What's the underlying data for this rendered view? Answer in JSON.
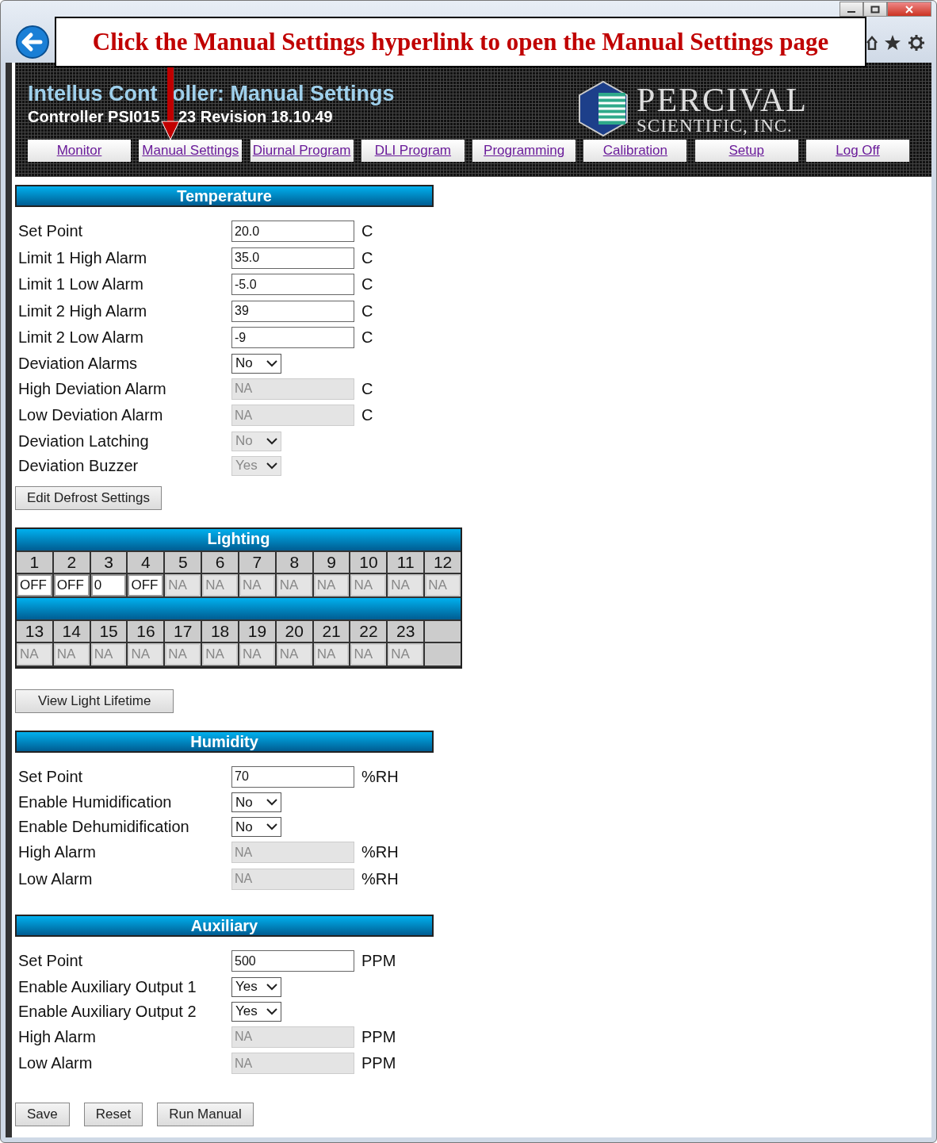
{
  "callout": {
    "text": "Click the Manual Settings hyperlink to open the Manual Settings page"
  },
  "header": {
    "title": [
      "Intellus Cont",
      "oller: Manual Settings"
    ],
    "subtitle": [
      "Controller PSI015",
      "23 Revision 18.10.49"
    ],
    "logo": {
      "name": "PERCIVAL",
      "tagline": "SCIENTIFIC, INC."
    }
  },
  "nav": [
    "Monitor",
    "Manual Settings",
    "Diurnal Program",
    "DLI Program",
    "Programming",
    "Calibration",
    "Setup",
    "Log Off"
  ],
  "sections": [
    {
      "kind": "form",
      "title": "Temperature",
      "rows": [
        {
          "label": "Set Point",
          "kind": "input",
          "value": "20.0",
          "disabled": false,
          "unit": "C"
        },
        {
          "label": "Limit 1 High Alarm",
          "kind": "input",
          "value": "35.0",
          "disabled": false,
          "unit": "C"
        },
        {
          "label": "Limit 1 Low Alarm",
          "kind": "input",
          "value": "-5.0",
          "disabled": false,
          "unit": "C"
        },
        {
          "label": "Limit 2 High Alarm",
          "kind": "input",
          "value": "39",
          "disabled": false,
          "unit": "C"
        },
        {
          "label": "Limit 2 Low Alarm",
          "kind": "input",
          "value": "-9",
          "disabled": false,
          "unit": "C"
        },
        {
          "label": "Deviation Alarms",
          "kind": "select",
          "value": "No",
          "disabled": false
        },
        {
          "label": "High Deviation Alarm",
          "kind": "input",
          "value": "NA",
          "disabled": true,
          "unit": "C"
        },
        {
          "label": "Low Deviation Alarm",
          "kind": "input",
          "value": "NA",
          "disabled": true,
          "unit": "C"
        },
        {
          "label": "Deviation Latching",
          "kind": "select",
          "value": "No",
          "disabled": true
        },
        {
          "label": "Deviation Buzzer",
          "kind": "select",
          "value": "Yes",
          "disabled": true
        }
      ],
      "button": "Edit Defrost Settings"
    },
    {
      "kind": "lighting",
      "title": "Lighting",
      "banks": [
        {
          "channels": [
            {
              "number": "1",
              "value": "OFF",
              "disabled": false
            },
            {
              "number": "2",
              "value": "OFF",
              "disabled": false
            },
            {
              "number": "3",
              "value": "0",
              "disabled": false
            },
            {
              "number": "4",
              "value": "OFF",
              "disabled": false
            },
            {
              "number": "5",
              "value": "NA",
              "disabled": true
            },
            {
              "number": "6",
              "value": "NA",
              "disabled": true
            },
            {
              "number": "7",
              "value": "NA",
              "disabled": true
            },
            {
              "number": "8",
              "value": "NA",
              "disabled": true
            },
            {
              "number": "9",
              "value": "NA",
              "disabled": true
            },
            {
              "number": "10",
              "value": "NA",
              "disabled": true
            },
            {
              "number": "11",
              "value": "NA",
              "disabled": true
            },
            {
              "number": "12",
              "value": "NA",
              "disabled": true
            }
          ]
        },
        {
          "channels": [
            {
              "number": "13",
              "value": "NA",
              "disabled": true
            },
            {
              "number": "14",
              "value": "NA",
              "disabled": true
            },
            {
              "number": "15",
              "value": "NA",
              "disabled": true
            },
            {
              "number": "16",
              "value": "NA",
              "disabled": true
            },
            {
              "number": "17",
              "value": "NA",
              "disabled": true
            },
            {
              "number": "18",
              "value": "NA",
              "disabled": true
            },
            {
              "number": "19",
              "value": "NA",
              "disabled": true
            },
            {
              "number": "20",
              "value": "NA",
              "disabled": true
            },
            {
              "number": "21",
              "value": "NA",
              "disabled": true
            },
            {
              "number": "22",
              "value": "NA",
              "disabled": true
            },
            {
              "number": "23",
              "value": "NA",
              "disabled": true
            }
          ]
        }
      ],
      "button": "View Light Lifetime"
    },
    {
      "kind": "form",
      "title": "Humidity",
      "rows": [
        {
          "label": "Set Point",
          "kind": "input",
          "value": "70",
          "disabled": false,
          "unit": "%RH"
        },
        {
          "label": "Enable Humidification",
          "kind": "select",
          "value": "No",
          "disabled": false
        },
        {
          "label": "Enable Dehumidification",
          "kind": "select",
          "value": "No",
          "disabled": false
        },
        {
          "label": "High Alarm",
          "kind": "input",
          "value": "NA",
          "disabled": true,
          "unit": "%RH"
        },
        {
          "label": "Low Alarm",
          "kind": "input",
          "value": "NA",
          "disabled": true,
          "unit": "%RH"
        }
      ]
    },
    {
      "kind": "form",
      "title": "Auxiliary",
      "rows": [
        {
          "label": "Set Point",
          "kind": "input",
          "value": "500",
          "disabled": false,
          "unit": "PPM"
        },
        {
          "label": "Enable Auxiliary Output 1",
          "kind": "select",
          "value": "Yes",
          "disabled": false
        },
        {
          "label": "Enable Auxiliary Output 2",
          "kind": "select",
          "value": "Yes",
          "disabled": false
        },
        {
          "label": "High Alarm",
          "kind": "input",
          "value": "NA",
          "disabled": true,
          "unit": "PPM"
        },
        {
          "label": "Low Alarm",
          "kind": "input",
          "value": "NA",
          "disabled": true,
          "unit": "PPM"
        }
      ]
    }
  ],
  "buttons": [
    "Save",
    "Reset",
    "Run Manual"
  ]
}
